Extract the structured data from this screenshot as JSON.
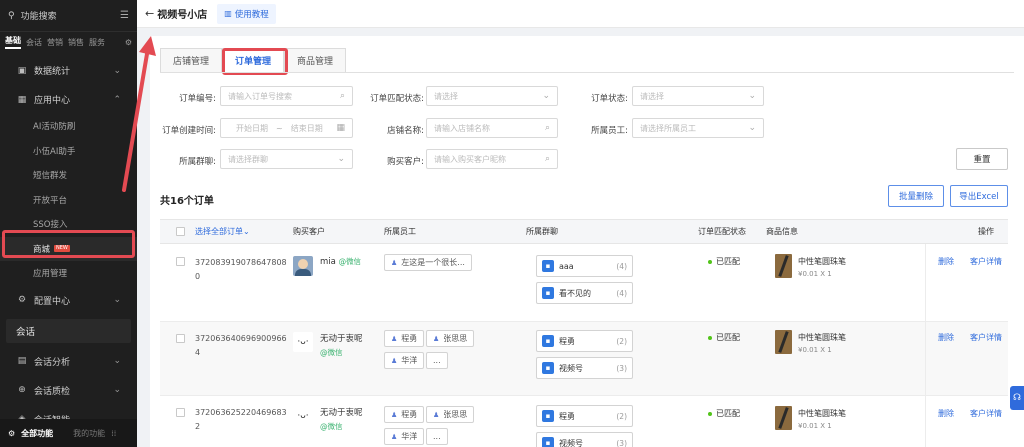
{
  "sidebar": {
    "search_placeholder": "功能搜索",
    "tabs": [
      "基础",
      "会话",
      "营销",
      "销售",
      "服务"
    ],
    "items": [
      {
        "label": "数据统计"
      },
      {
        "label": "应用中心"
      }
    ],
    "subitems": [
      "AI活动防刷",
      "小伍AI助手",
      "短信群发",
      "开放平台",
      "SSO接入",
      "商城",
      "应用管理"
    ],
    "new_badge": "NEW",
    "config_label": "配置中心",
    "section_label": "会话",
    "items2": [
      {
        "label": "会话分析"
      },
      {
        "label": "会话质检"
      },
      {
        "label": "会话智能"
      }
    ],
    "footer": {
      "all": "全部功能",
      "mine": "我的功能"
    }
  },
  "header": {
    "title": "视频号小店",
    "tutorial": "使用教程"
  },
  "tabs": [
    "店铺管理",
    "订单管理",
    "商品管理"
  ],
  "filters": {
    "order_no": {
      "label": "订单编号:",
      "placeholder": "请输入订单号搜索"
    },
    "match_status": {
      "label": "订单匹配状态:",
      "placeholder": "请选择"
    },
    "order_status": {
      "label": "订单状态:",
      "placeholder": "请选择"
    },
    "created_time": {
      "label": "订单创建时间:",
      "start": "开始日期",
      "sep": "~",
      "end": "结束日期"
    },
    "shop_name": {
      "label": "店铺名称:",
      "placeholder": "请输入店铺名称"
    },
    "employee": {
      "label": "所属员工:",
      "placeholder": "请选择所属员工"
    },
    "group_chat": {
      "label": "所属群聊:",
      "placeholder": "请选择群聊"
    },
    "customer": {
      "label": "购买客户:",
      "placeholder": "请输入购买客户昵称"
    }
  },
  "buttons": {
    "reset": "重置",
    "batch_delete": "批量删除",
    "export": "导出Excel"
  },
  "total_text": "共16个订单",
  "table": {
    "headers": {
      "select_all": "选择全部订单",
      "customer": "购买客户",
      "employee": "所属员工",
      "group": "所属群聊",
      "match": "订单匹配状态",
      "product": "商品信息",
      "action": "操作"
    },
    "rows": [
      {
        "order_no": "3720839190786478080",
        "customer": "mia",
        "channel": "@微信",
        "employees": [
          "左这是一个很长..."
        ],
        "groups": [
          {
            "name": "aaa",
            "count": "(4)"
          },
          {
            "name": "看不见的",
            "count": "(4)"
          }
        ],
        "status": "已匹配",
        "product": "中性笔圆珠笔",
        "price": "¥0.01 X 1",
        "actions": [
          "删除",
          "客户详情"
        ]
      },
      {
        "order_no": "3720636406969009664",
        "customer": "无动于衷呢",
        "channel": "@微信",
        "employees": [
          "程勇",
          "张思思",
          "华洋",
          "..."
        ],
        "groups": [
          {
            "name": "程勇",
            "count": "(2)"
          },
          {
            "name": "视频号",
            "count": "(3)"
          }
        ],
        "status": "已匹配",
        "product": "中性笔圆珠笔",
        "price": "¥0.01 X 1",
        "actions": [
          "删除",
          "客户详情"
        ]
      },
      {
        "order_no": "3720636252204696832",
        "customer": "无动于衷呢",
        "channel": "@微信",
        "employees": [
          "程勇",
          "张思思",
          "华洋",
          "..."
        ],
        "groups": [
          {
            "name": "程勇",
            "count": "(2)"
          },
          {
            "name": "视频号",
            "count": "(3)"
          }
        ],
        "status": "已匹配",
        "product": "中性笔圆珠笔",
        "price": "¥0.01 X 1",
        "actions": [
          "删除",
          "客户详情"
        ]
      }
    ]
  },
  "colors": {
    "accent": "#2f6bdc",
    "highlight": "#e34a52",
    "sidebar": "#1f1f1f",
    "success": "#52c41a"
  }
}
